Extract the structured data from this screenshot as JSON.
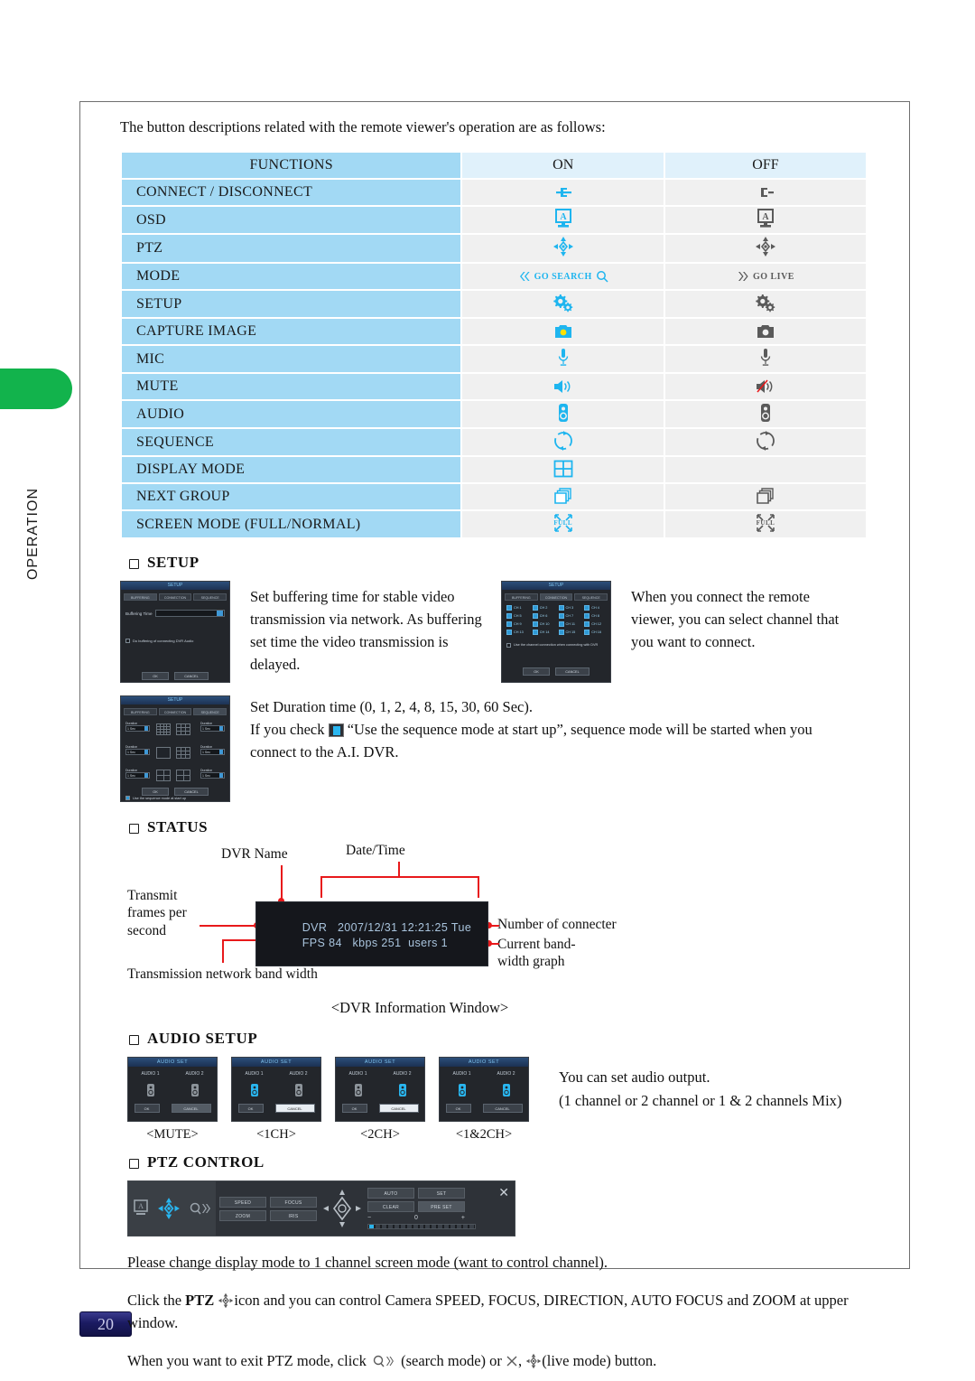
{
  "sidebar": {
    "section_label": "OPERATION",
    "page_number": "20"
  },
  "intro": "The button descriptions related with the remote viewer's operation are as follows:",
  "table": {
    "headers": [
      "FUNCTIONS",
      "ON",
      "OFF"
    ],
    "rows": [
      {
        "function": "CONNECT / DISCONNECT",
        "on_icon": "connect-plug-icon",
        "off_icon": "disconnect-plug-icon"
      },
      {
        "function": "OSD",
        "on_icon": "osd-monitor-icon",
        "off_icon": "osd-monitor-icon"
      },
      {
        "function": "PTZ",
        "on_icon": "ptz-dpad-icon",
        "off_icon": "ptz-dpad-icon"
      },
      {
        "function": "MODE",
        "on_icon": "go-search-icon",
        "off_icon": "go-live-icon",
        "on_label": "GO SEARCH",
        "off_label": "GO LIVE"
      },
      {
        "function": "SETUP",
        "on_icon": "gears-icon",
        "off_icon": "gears-icon"
      },
      {
        "function": "CAPTURE IMAGE",
        "on_icon": "camera-icon",
        "off_icon": "camera-icon"
      },
      {
        "function": "MIC",
        "on_icon": "microphone-icon",
        "off_icon": "microphone-icon"
      },
      {
        "function": "MUTE",
        "on_icon": "speaker-icon",
        "off_icon": "speaker-muted-icon"
      },
      {
        "function": "AUDIO",
        "on_icon": "audio-speaker-icon",
        "off_icon": "audio-speaker-icon"
      },
      {
        "function": "SEQUENCE",
        "on_icon": "sequence-loop-icon",
        "off_icon": "sequence-loop-icon"
      },
      {
        "function": "DISPLAY MODE",
        "on_icon": "grid-four-icon",
        "off_icon": ""
      },
      {
        "function": "NEXT GROUP",
        "on_icon": "next-group-pages-icon",
        "off_icon": "next-group-pages-icon"
      },
      {
        "function": "SCREEN MODE (FULL/NORMAL)",
        "on_icon": "full-screen-icon",
        "off_icon": "full-screen-icon",
        "on_label": "FULL",
        "off_label": "FULL"
      }
    ]
  },
  "setup": {
    "heading": "SETUP",
    "text_left": "Set buffering time for stable video transmission via network. As buffering set time the video transmission is delayed.",
    "text_right": "When you connect the remote viewer, you can select channel that you want to connect.",
    "duration_line": "Set Duration time (0, 1, 2, 4, 8, 15, 30, 60 Sec).",
    "sequence_line_a": "If you check",
    "sequence_line_b": "“Use the sequence mode at start up”, sequence mode will be  started when you connect to the A.I. DVR.",
    "dialog1": {
      "title": "SETUP",
      "tabs": [
        "BUFFERING",
        "CONNECTION",
        "SEQUENCE"
      ],
      "field_label": "Buffering Time",
      "field_value": "3 sec",
      "checkbox_label": "Do buffering of connecting DVR Audio",
      "buttons": [
        "OK",
        "CANCEL"
      ]
    },
    "dialog2": {
      "title": "SETUP",
      "tabs": [
        "BUFFERING",
        "CONNECTION",
        "SEQUENCE"
      ],
      "channels": [
        "CH 1",
        "CH 2",
        "CH 3",
        "CH 4",
        "CH 5",
        "CH 6",
        "CH 7",
        "CH 8",
        "CH 9",
        "CH 10",
        "CH 11",
        "CH 12",
        "CH 13",
        "CH 14",
        "CH 15",
        "CH 16"
      ],
      "note": "Use the channel connection when connecting with DVR",
      "buttons": [
        "OK",
        "CANCEL"
      ]
    },
    "dialog3": {
      "title": "SETUP",
      "tabs": [
        "BUFFERING",
        "CONNECTION",
        "SEQUENCE"
      ],
      "duration_label": "Duration",
      "duration_value": "1 Sec",
      "checkbox_label": "Use the sequence mode at start up",
      "buttons": [
        "OK",
        "CANCEL"
      ]
    }
  },
  "status": {
    "heading": "STATUS",
    "labels": {
      "dvr_name": "DVR Name",
      "date_time": "Date/Time",
      "transmit_fps": "Transmit\nframes per\nsecond",
      "bandwidth": "Transmission network band width",
      "connecter": "Number of connecter",
      "graph": "Current band-\nwidth graph"
    },
    "window": {
      "name": "DVR",
      "datetime": "2007/12/31 12:21:25 Tue",
      "fps_label": "FPS",
      "fps_value": "84",
      "kbps_label": "kbps",
      "kbps_value": "251",
      "users_label": "users",
      "users_value": "1"
    },
    "caption": "<DVR Information Window>"
  },
  "audio": {
    "heading": "AUDIO SETUP",
    "dialog_title": "AUDIO SET",
    "ch_labels": [
      "AUDIO 1",
      "AUDIO 2"
    ],
    "buttons": [
      "OK",
      "CANCEL"
    ],
    "captions": [
      "<MUTE>",
      "<1CH>",
      "<2CH>",
      "<1&2CH>"
    ],
    "desc_line1": "You can set audio output.",
    "desc_line2": "(1 channel or 2 channel or 1 & 2 channels Mix)"
  },
  "ptz": {
    "heading": "PTZ CONTROL",
    "bar_buttons": [
      "SPEED",
      "FOCUS",
      "ZOOM",
      "IRIS",
      "AUTO",
      "SET",
      "CLEAR",
      "PRE SET"
    ],
    "preset_value": "0",
    "para1": "Please change display mode to 1 channel screen mode (want to control channel).",
    "para2_a": "Click the",
    "para2_bold": "PTZ",
    "para2_b": "icon and you can control Camera SPEED, FOCUS, DIRECTION, AUTO FOCUS and ZOOM at upper window.",
    "para3_a": "When you want to exit PTZ mode, click",
    "para3_b": "(search mode) or",
    "para3_c": ",",
    "para3_d": "(live mode) button."
  },
  "colors": {
    "accent_blue": "#1eb5ef",
    "header_blue": "#a2d9f4",
    "subheader_blue": "#e0f1fb",
    "cell_gray": "#f0f0f0",
    "green_tab": "#12b34c",
    "page_badge": "#1b1b62",
    "annotation_red": "#e8191b"
  }
}
